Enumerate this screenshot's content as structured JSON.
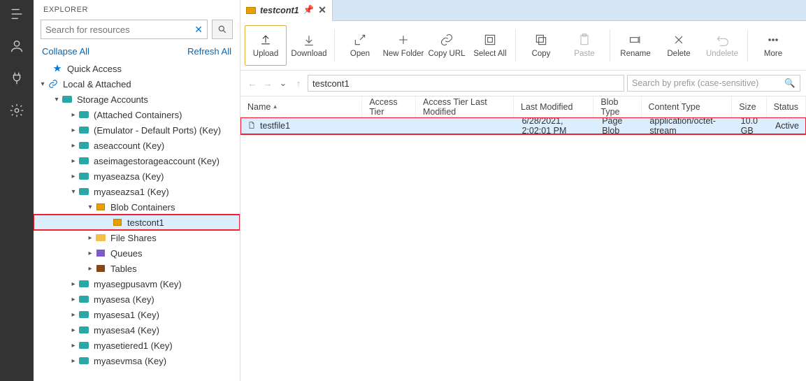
{
  "explorer": {
    "title": "EXPLORER",
    "search_placeholder": "Search for resources",
    "collapse": "Collapse All",
    "refresh": "Refresh All",
    "quick_access": "Quick Access",
    "local_attached": "Local & Attached",
    "storage_accounts": "Storage Accounts",
    "nodes": {
      "attached": "(Attached Containers)",
      "emulator": "(Emulator - Default Ports) (Key)",
      "aseaccount": "aseaccount (Key)",
      "aseimage": "aseimagestorageaccount (Key)",
      "myaseazsa": "myaseazsa (Key)",
      "myaseazsa1": "myaseazsa1 (Key)",
      "blob_containers": "Blob Containers",
      "testcont1": "testcont1",
      "file_shares": "File Shares",
      "queues": "Queues",
      "tables": "Tables",
      "myasegpusavm": "myasegpusavm (Key)",
      "myasesa": "myasesa (Key)",
      "myasesa1": "myasesa1 (Key)",
      "myasesa4": "myasesa4 (Key)",
      "myasetiered1": "myasetiered1 (Key)",
      "myasevmsa": "myasevmsa (Key)"
    }
  },
  "tab": {
    "title": "testcont1"
  },
  "toolbar": {
    "upload": "Upload",
    "download": "Download",
    "open": "Open",
    "new_folder": "New Folder",
    "copy_url": "Copy URL",
    "select_all": "Select All",
    "copy": "Copy",
    "paste": "Paste",
    "rename": "Rename",
    "delete": "Delete",
    "undelete": "Undelete",
    "more": "More"
  },
  "nav": {
    "path": "testcont1",
    "filter_placeholder": "Search by prefix (case-sensitive)"
  },
  "columns": {
    "name": "Name",
    "access_tier": "Access Tier",
    "access_tier_last_modified": "Access Tier Last Modified",
    "last_modified": "Last Modified",
    "blob_type": "Blob Type",
    "content_type": "Content Type",
    "size": "Size",
    "status": "Status"
  },
  "rows": [
    {
      "name": "testfile1",
      "last_modified": "6/28/2021, 2:02:01 PM",
      "blob_type": "Page Blob",
      "content_type": "application/octet-stream",
      "size": "10.0 GB",
      "status": "Active"
    }
  ]
}
